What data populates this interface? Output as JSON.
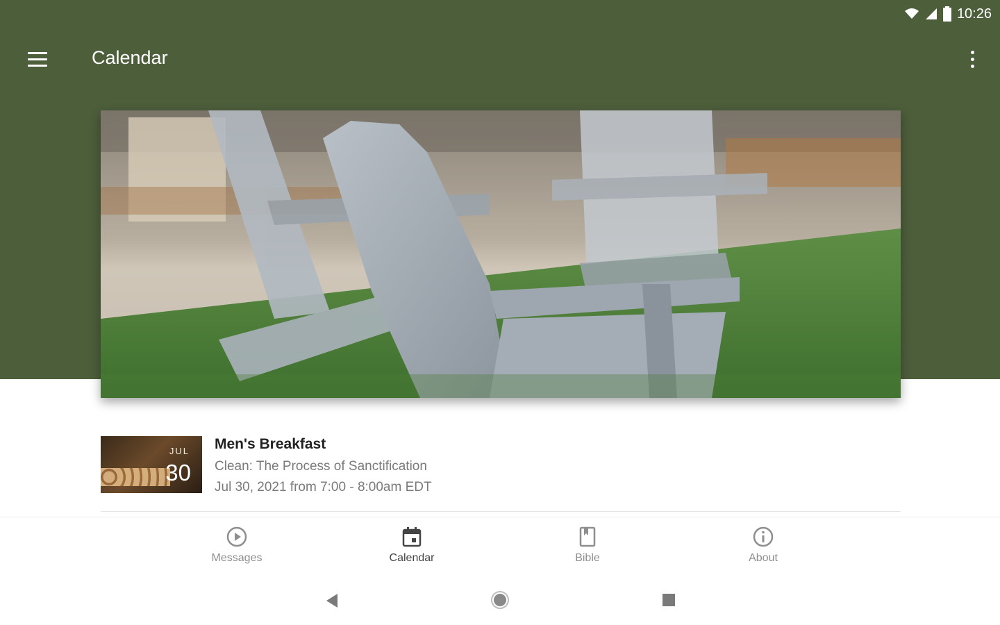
{
  "status_bar": {
    "time": "10:26"
  },
  "app_bar": {
    "title": "Calendar"
  },
  "event": {
    "thumb_month": "JUL",
    "thumb_day": "30",
    "title": "Men's Breakfast",
    "subtitle": "Clean: The Process of Sanctification",
    "when": "Jul 30, 2021 from 7:00 - 8:00am EDT"
  },
  "bottom_nav": {
    "items": [
      {
        "label": "Messages",
        "icon": "play-circle-icon"
      },
      {
        "label": "Calendar",
        "icon": "calendar-icon"
      },
      {
        "label": "Bible",
        "icon": "book-icon"
      },
      {
        "label": "About",
        "icon": "info-icon"
      }
    ],
    "active": "Calendar"
  },
  "colors": {
    "header": "#4d5e3b",
    "active_nav": "#444444",
    "inactive_nav": "#8e8e8e"
  }
}
